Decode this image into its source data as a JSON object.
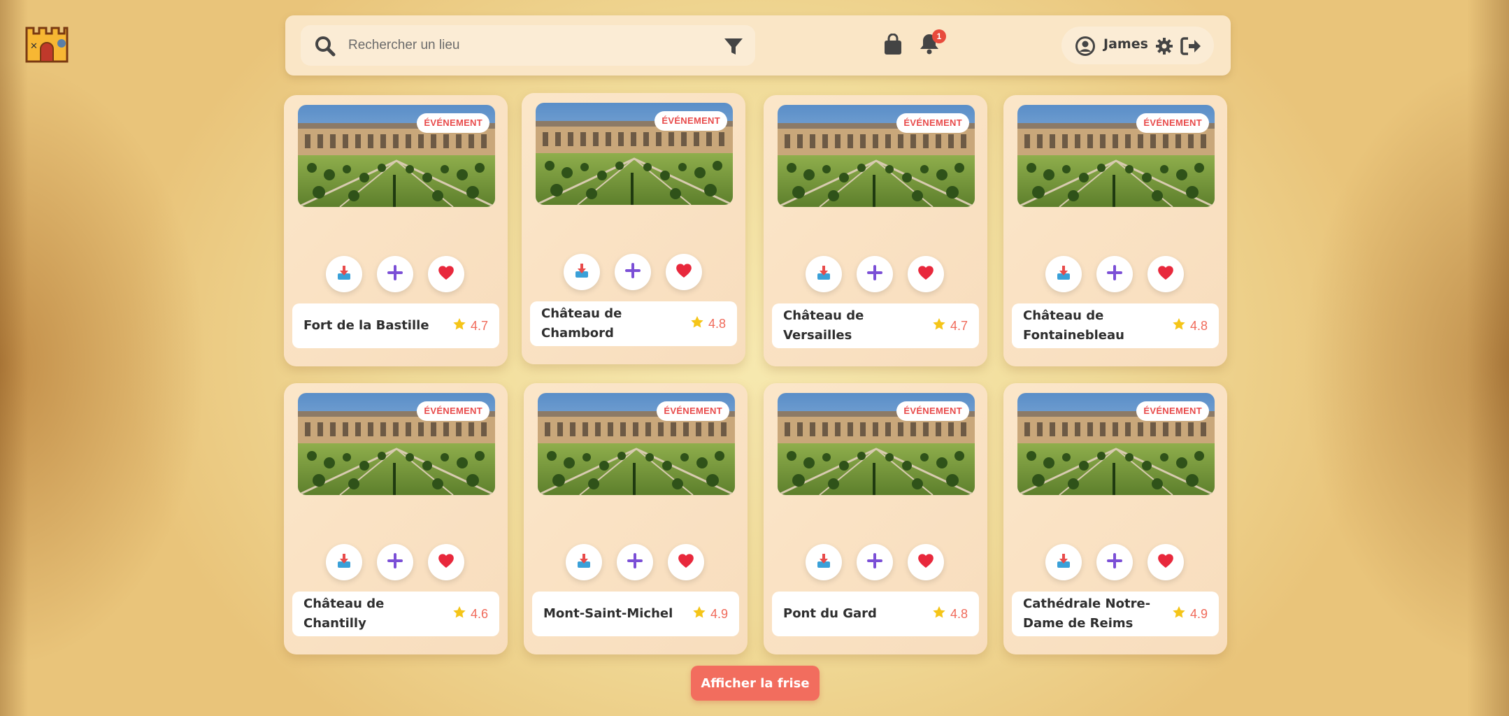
{
  "header": {
    "search_placeholder": "Rechercher un lieu",
    "notification_count": "1",
    "user_name": "James"
  },
  "event_badge": "ÉVÉNEMENT",
  "cards": [
    {
      "title": "Fort de la Bastille",
      "rating": "4.7"
    },
    {
      "title": "Château de Chambord",
      "rating": "4.8"
    },
    {
      "title": "Château de Versailles",
      "rating": "4.7"
    },
    {
      "title": "Château de Fontainebleau",
      "rating": "4.8"
    },
    {
      "title": "Château de Chantilly",
      "rating": "4.6"
    },
    {
      "title": "Mont-Saint-Michel",
      "rating": "4.9"
    },
    {
      "title": "Pont du Gard",
      "rating": "4.8"
    },
    {
      "title": "Cathédrale Notre-Dame de Reims",
      "rating": "4.9"
    }
  ],
  "footer": {
    "frise_button": "Afficher la frise"
  },
  "colors": {
    "accent": "#f26d5e",
    "badge_text": "#e84b4b",
    "plus_icon": "#7b4fd6",
    "heart_icon": "#e8283c",
    "star_icon": "#f5c518"
  },
  "icons": [
    "search-icon",
    "filter-icon",
    "shopping-bag-icon",
    "bell-icon",
    "user-circle-icon",
    "gear-icon",
    "logout-icon",
    "download-icon",
    "plus-icon",
    "heart-icon",
    "star-icon"
  ]
}
